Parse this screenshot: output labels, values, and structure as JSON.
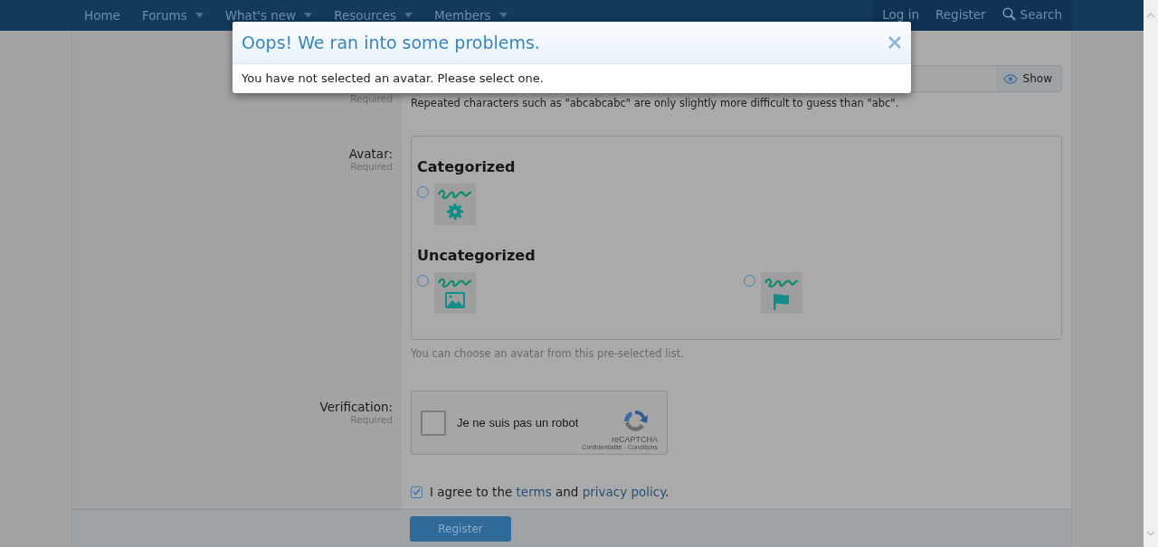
{
  "nav": {
    "items": [
      {
        "label": "Home",
        "has_menu": false
      },
      {
        "label": "Forums",
        "has_menu": true
      },
      {
        "label": "What's new",
        "has_menu": true
      },
      {
        "label": "Resources",
        "has_menu": true
      },
      {
        "label": "Members",
        "has_menu": true
      }
    ],
    "right": [
      {
        "label": "Log in",
        "kind": "link"
      },
      {
        "label": "Register",
        "kind": "link"
      },
      {
        "label": "Search",
        "kind": "search"
      }
    ]
  },
  "modal": {
    "title": "Oops! We ran into some problems.",
    "message": "You have not selected an avatar. Please select one."
  },
  "password": {
    "required_note": "Required",
    "show_label": "Show",
    "hint": "Repeated characters such as \"abcabcabc\" are only slightly more difficult to guess than \"abc\"."
  },
  "avatar": {
    "label": "Avatar:",
    "required_note": "Required",
    "groups": [
      {
        "title": "Categorized",
        "options": [
          {
            "kind": "gear",
            "selected": false
          }
        ]
      },
      {
        "title": "Uncategorized",
        "options": [
          {
            "kind": "picture",
            "selected": false
          },
          {
            "kind": "flag",
            "selected": false
          }
        ]
      }
    ],
    "hint": "You can choose an avatar from this pre-selected list."
  },
  "verification": {
    "label": "Verification:",
    "required_note": "Required",
    "checkbox_label": "Je ne suis pas un robot",
    "checked": false,
    "brand": "reCAPTCHA",
    "links": "Confidentialité - Conditions"
  },
  "agree": {
    "checked": true,
    "before": "I agree to the",
    "link1": "terms",
    "middle": "and",
    "link2": "privacy policy",
    "after": "."
  },
  "submit": {
    "label": "Register"
  }
}
